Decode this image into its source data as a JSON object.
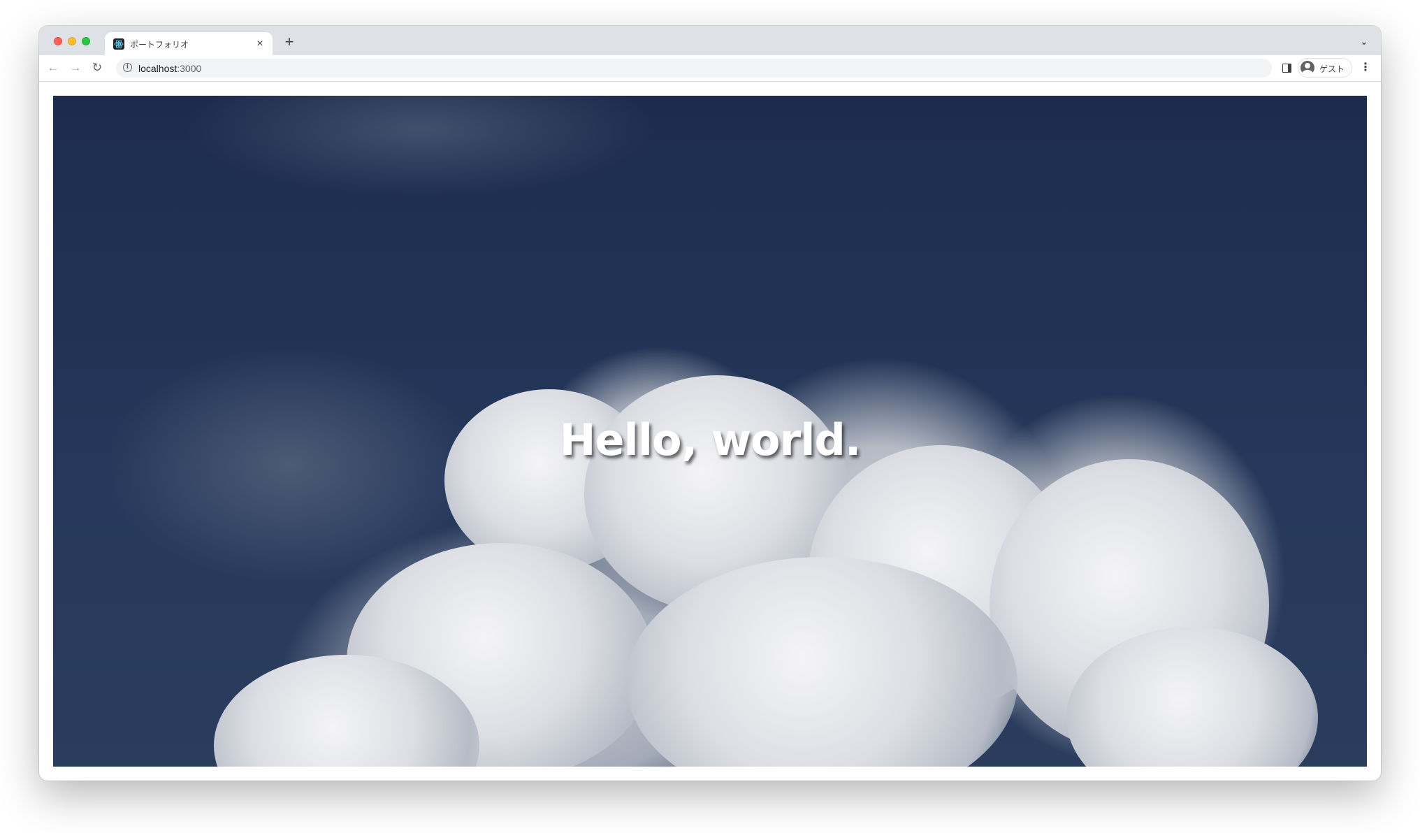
{
  "browser": {
    "tab": {
      "title": "ポートフォリオ",
      "close_label": "×",
      "favicon": "react-icon"
    },
    "new_tab_label": "+",
    "tab_search_label": "⌄",
    "toolbar": {
      "back_label": "←",
      "forward_label": "→",
      "reload_label": "↻",
      "info_label": "i",
      "url_host": "localhost",
      "url_port": ":3000",
      "profile_label": "ゲスト",
      "menu_label": "⋮"
    }
  },
  "page": {
    "hero": {
      "title": "Hello, world."
    }
  },
  "colors": {
    "tabstrip": "#dee1e6",
    "sky": "#1d2c4d",
    "cloud": "#e6e7ea",
    "title": "#ffffff"
  }
}
